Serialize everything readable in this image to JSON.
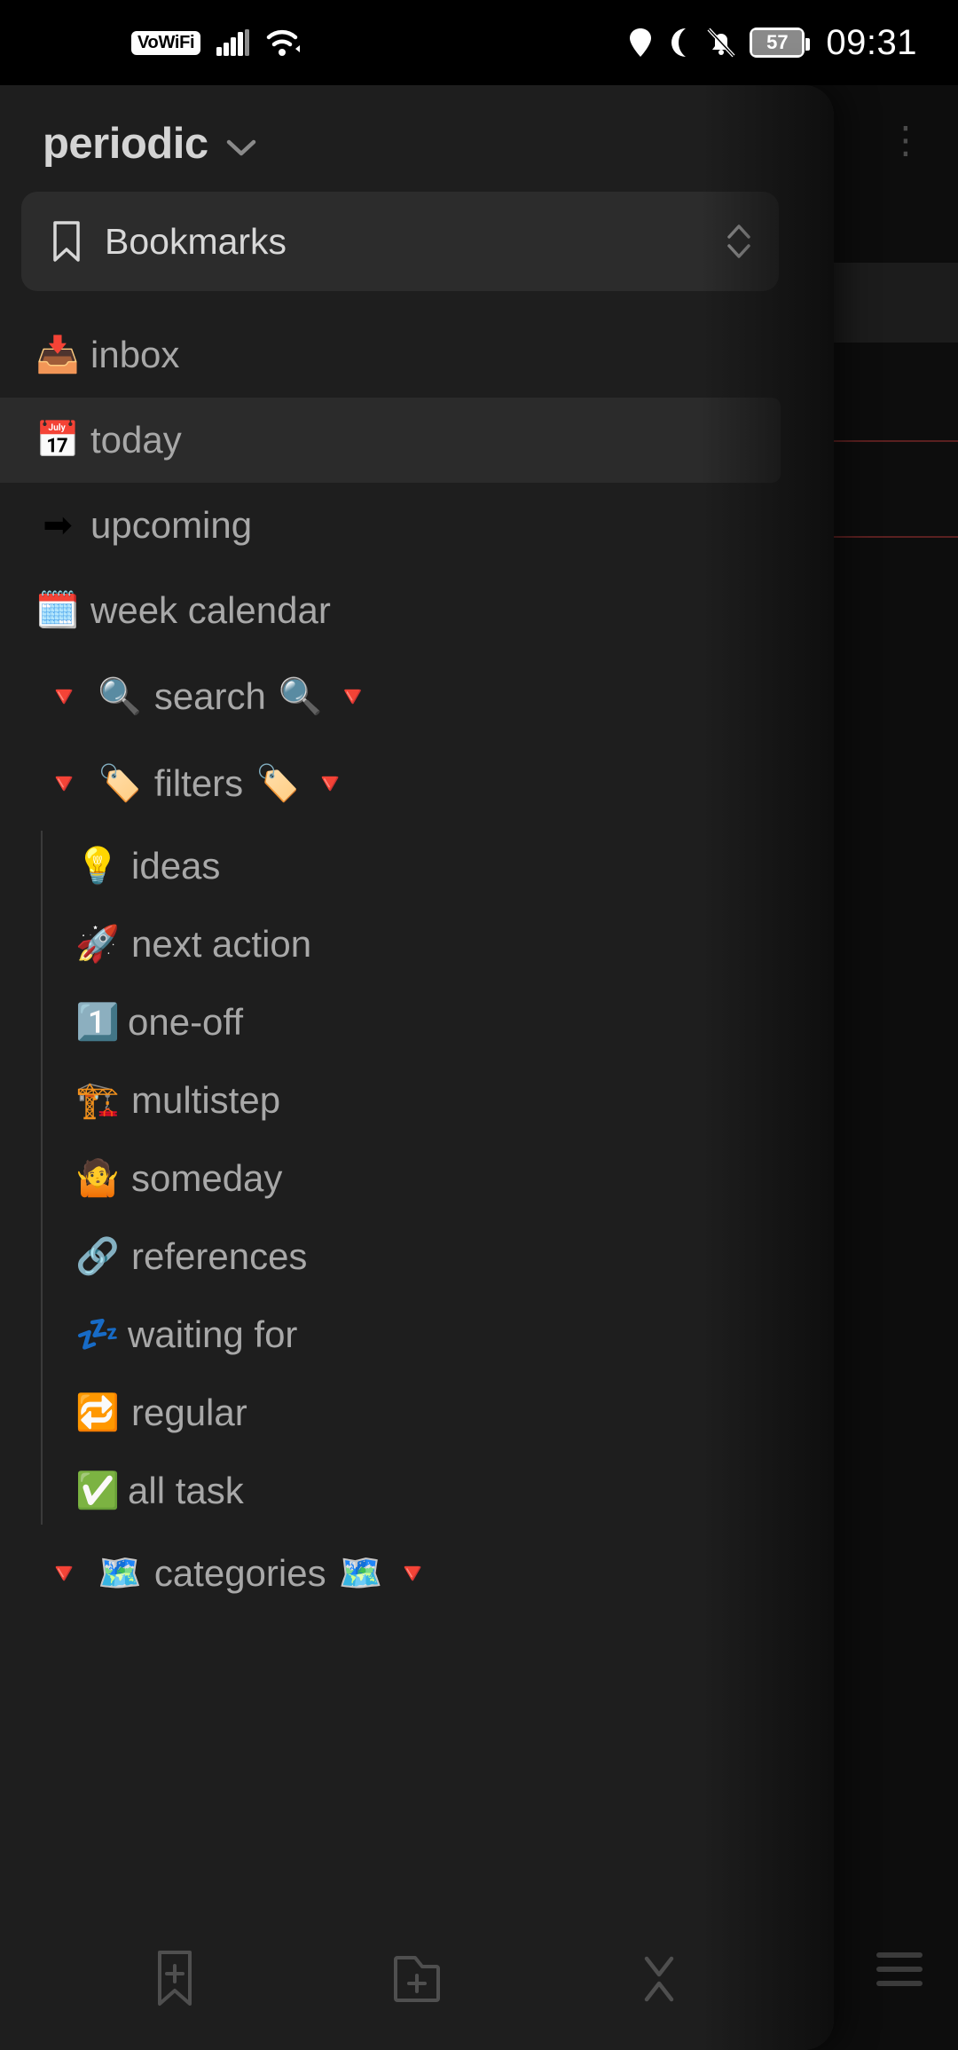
{
  "statusbar": {
    "vowifi_label": "VoWiFi",
    "signal_icon": "cellular-signal-icon",
    "wifi_icon": "wifi-calling-icon",
    "location_icon": "location-pin-icon",
    "dnd_icon": "crescent-moon-icon",
    "mute_icon": "bell-muted-icon",
    "battery_level": "57",
    "time": "09:31"
  },
  "header": {
    "vault_name": "periodic",
    "chevron_icon": "chevron-down-icon"
  },
  "bookmarks": {
    "label": "Bookmarks",
    "icon": "bookmark-icon",
    "sort_icon": "up-down-chevrons-icon"
  },
  "nav": {
    "items": [
      {
        "emoji": "📥",
        "icon_name": "inbox-tray-icon",
        "label": "inbox",
        "selected": false
      },
      {
        "emoji": "📅",
        "icon_name": "calendar-icon",
        "label": "today",
        "selected": true
      },
      {
        "emoji": "➡",
        "icon_name": "right-arrow-icon",
        "label": "upcoming",
        "selected": false
      },
      {
        "emoji": "🗓️",
        "icon_name": "spiral-calendar-icon",
        "label": "week calendar",
        "selected": false
      }
    ]
  },
  "sections": [
    {
      "id": "search",
      "label": "search",
      "left_triangle": "🔻",
      "left_emoji": "🔍",
      "right_emoji": "🔍",
      "right_triangle": "🔻",
      "expanded": true,
      "children": []
    },
    {
      "id": "filters",
      "label": "filters",
      "left_triangle": "🔻",
      "left_emoji": "🏷️",
      "right_emoji": "🏷️",
      "right_triangle": "🔻",
      "expanded": true,
      "children": [
        {
          "emoji": "💡",
          "icon_name": "lightbulb-icon",
          "label": "ideas"
        },
        {
          "emoji": "🚀",
          "icon_name": "rocket-icon",
          "label": "next action"
        },
        {
          "emoji": "1️⃣",
          "icon_name": "keycap-one-icon",
          "label": "one-off"
        },
        {
          "emoji": "🏗️",
          "icon_name": "construction-crane-icon",
          "label": "multistep"
        },
        {
          "emoji": "🤷",
          "icon_name": "person-shrugging-icon",
          "label": "someday"
        },
        {
          "emoji": "🔗",
          "icon_name": "link-chain-icon",
          "label": "references"
        },
        {
          "emoji": "💤",
          "icon_name": "zzz-sleep-icon",
          "label": "waiting for"
        },
        {
          "emoji": "🔁",
          "icon_name": "repeat-icon",
          "label": "regular"
        },
        {
          "emoji": "✅",
          "icon_name": "check-mark-icon",
          "label": "all task"
        }
      ]
    },
    {
      "id": "categories",
      "label": "categories",
      "left_triangle": "🔻",
      "left_emoji": "🗺️",
      "right_emoji": "🗺️",
      "right_triangle": "🔻",
      "expanded": true,
      "children": []
    }
  ],
  "footer": {
    "buttons": [
      {
        "icon_name": "new-note-bookmark-icon",
        "label": ""
      },
      {
        "icon_name": "new-folder-icon",
        "label": ""
      },
      {
        "icon_name": "collapse-all-icon",
        "label": ""
      }
    ]
  },
  "background": {
    "kebab_icon": "more-options-icon",
    "hamburger_icon": "menu-icon"
  },
  "colors": {
    "drawer_bg": "#1e1e1e",
    "selected_bg": "#2b2b2b",
    "text": "#a8a8a8",
    "accent_red": "#e53935"
  }
}
